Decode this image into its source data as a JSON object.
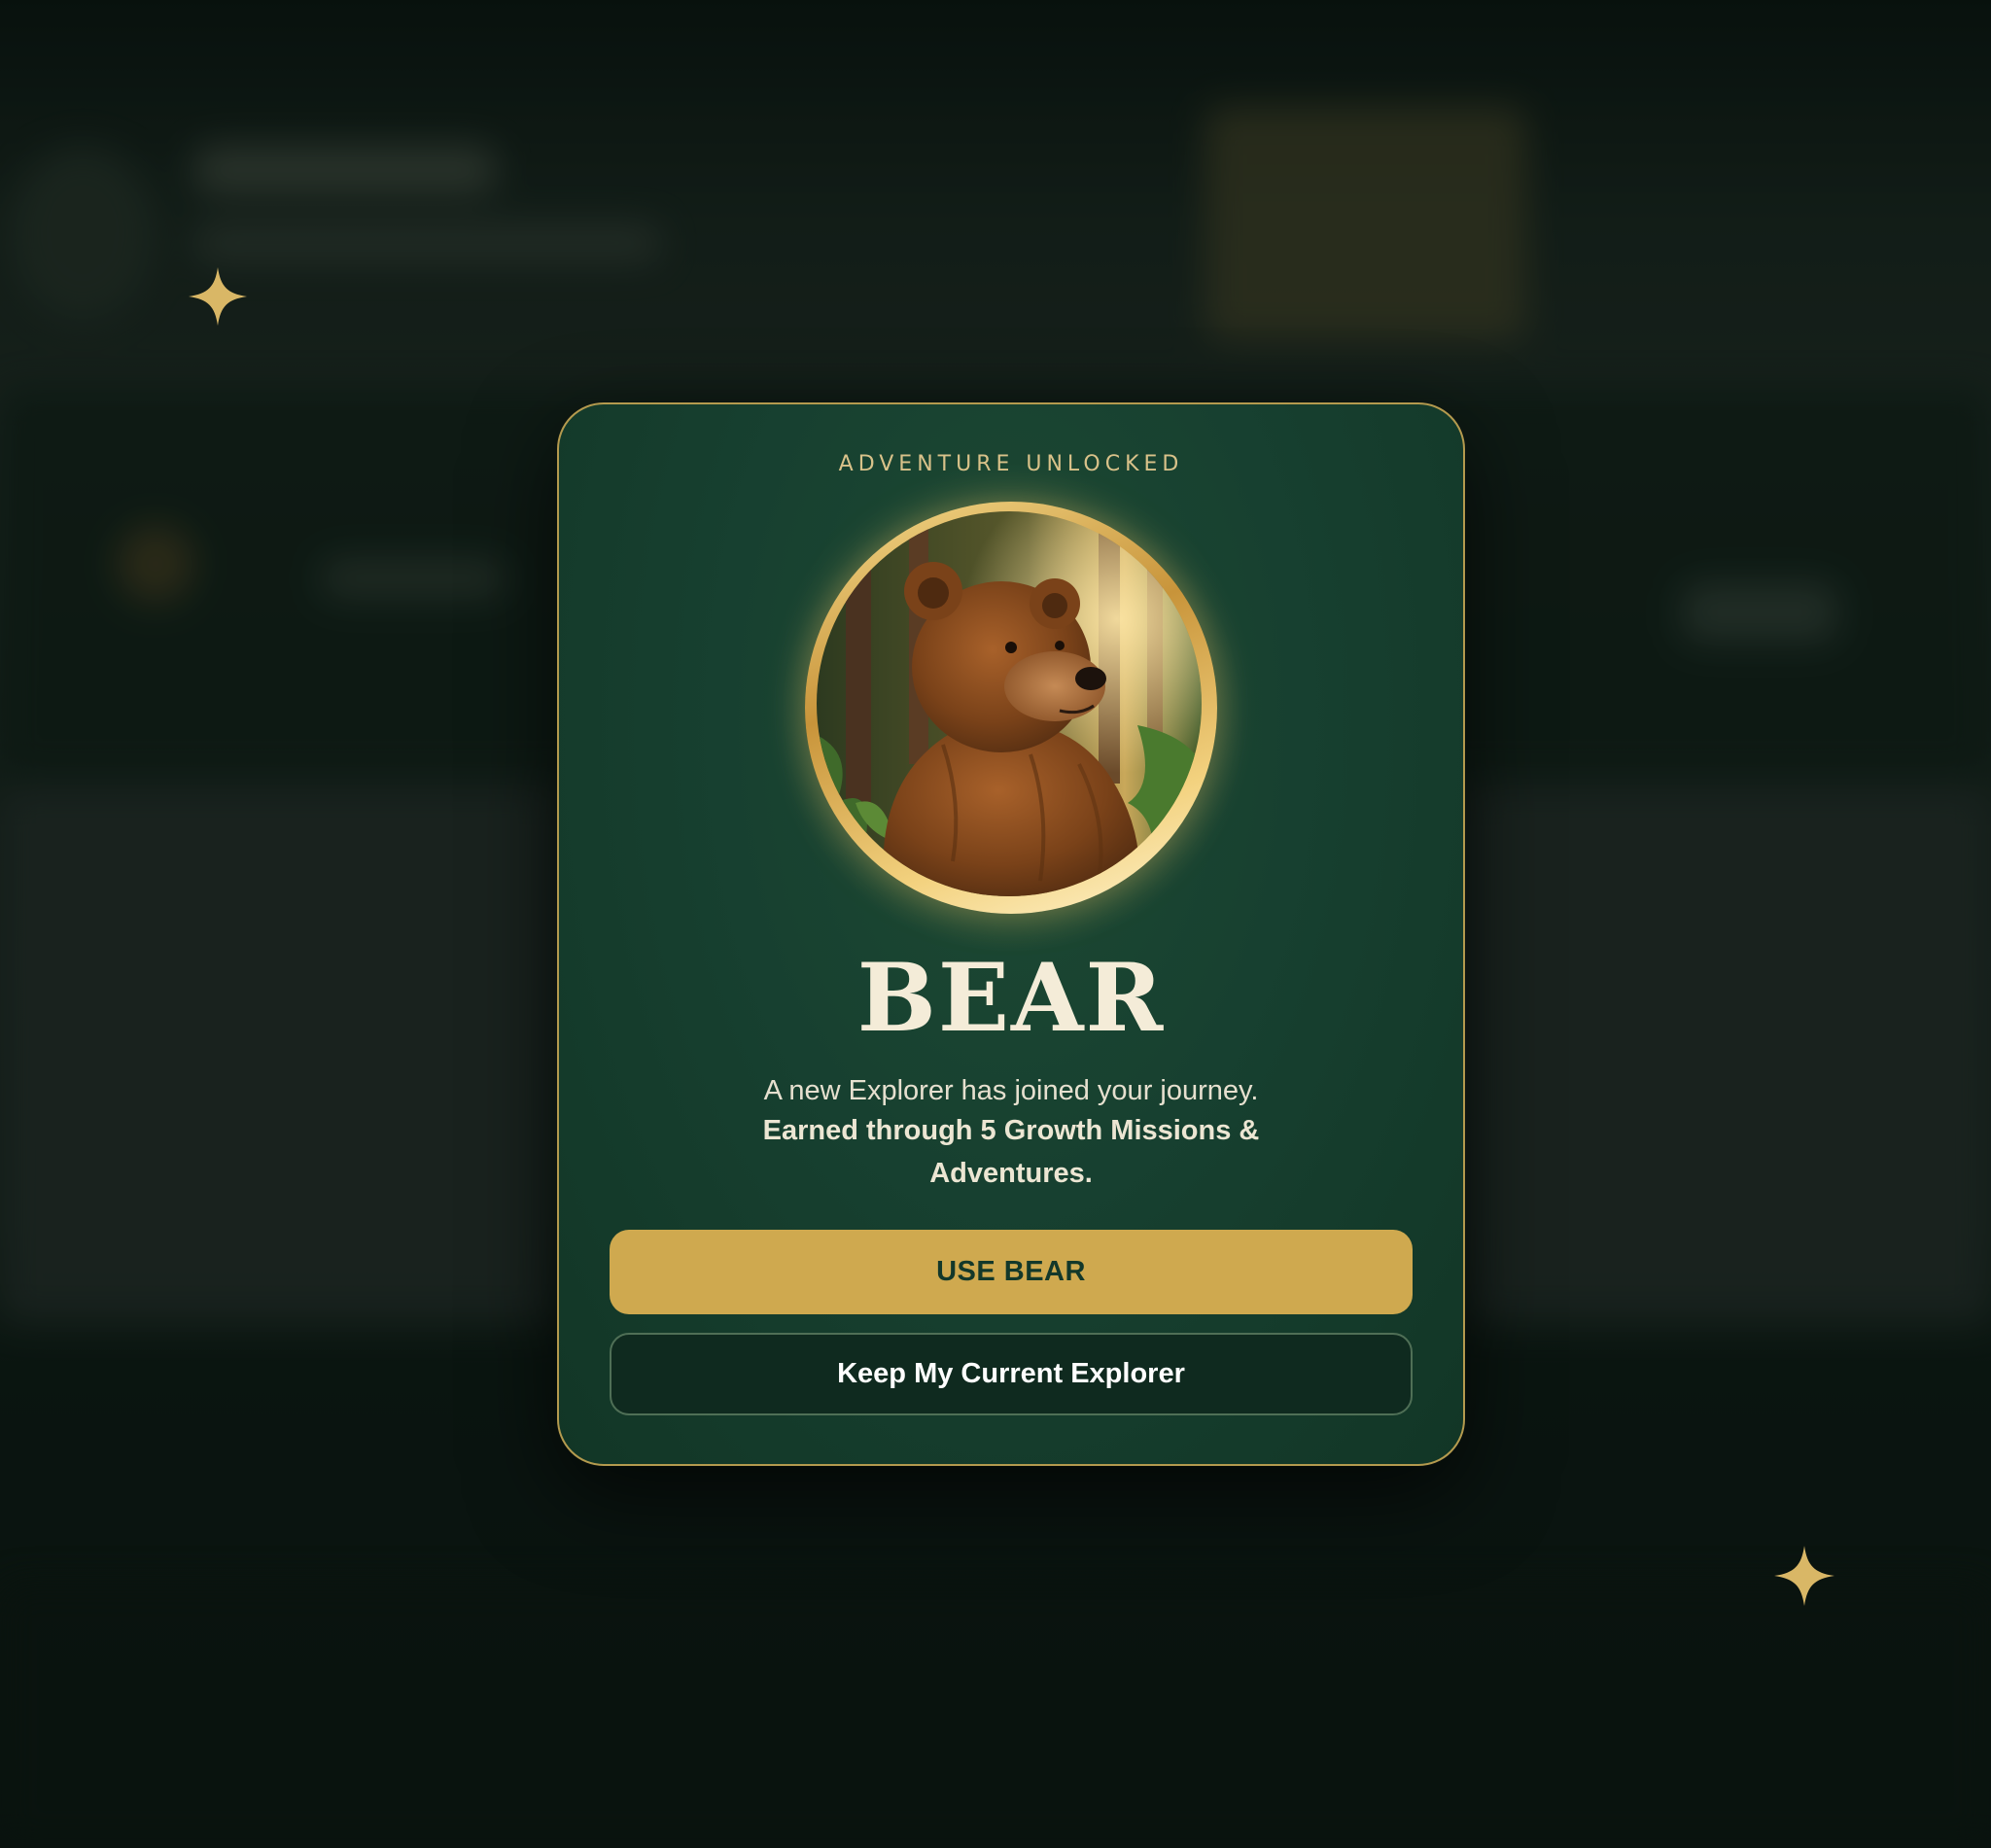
{
  "modal": {
    "eyebrow": "ADVENTURE UNLOCKED",
    "title": "BEAR",
    "description": "A new Explorer has joined your journey.",
    "description_strong": "Earned through 5 Growth Missions & Adventures.",
    "primary_button": "USE BEAR",
    "secondary_button": "Keep My Current Explorer",
    "avatar_icon": "bear-portrait"
  },
  "colors": {
    "accent_gold": "#cfa94f",
    "modal_green": "#174030",
    "title_cream": "#f4ecd8",
    "border_gold": "#b49a4e"
  }
}
